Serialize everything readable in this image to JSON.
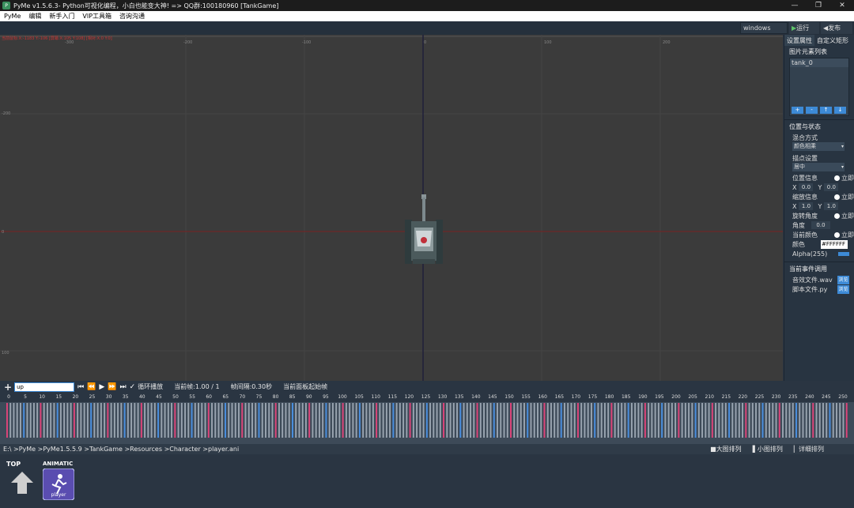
{
  "window": {
    "title": "PyMe v1.5.6.3- Python可视化编程，小白也能变大神!  => QQ群:100180960   [TankGame]",
    "minimize": "—",
    "maximize": "❐",
    "close": "✕"
  },
  "menu": [
    "PyMe",
    "编辑",
    "新手入门",
    "VIP工具箱",
    "咨询沟通"
  ],
  "toolbar": {
    "platform": "windows",
    "run_label": "运行",
    "publish_label": "发布"
  },
  "canvas": {
    "coords_text": "当前鼠标:X:-1183 Y:-106 [屏幕:X:105 Y:108] [相对:X:0 Y:0]",
    "ruler_h": [
      "-300",
      "-200",
      "-100",
      "0",
      "100",
      "200"
    ],
    "ruler_v": [
      "-200",
      "-100",
      "0",
      "100"
    ],
    "sprite_name": "tank_0"
  },
  "panel": {
    "tab_props": "设置属性",
    "tab_custom": "自定义矩形",
    "image_list_title": "图片元素列表",
    "image_items": [
      "tank_0"
    ],
    "list_btns": [
      "+",
      "-",
      "↑",
      "↓"
    ],
    "pos_state_title": "位置与状态",
    "blend_label": "混合方式",
    "blend_value": "颜色相乘",
    "anchor_label": "描点设置",
    "anchor_value": "居中",
    "position_label": "位置信息",
    "scale_label": "缩放信息",
    "rotation_label": "旋转角度",
    "current_color_label": "当前颜色",
    "immediate": "立即",
    "pos_x_label": "X",
    "pos_x": "0.0",
    "pos_y_label": "Y",
    "pos_y": "0.0",
    "scale_x_label": "X",
    "scale_x": "1.0",
    "scale_y_label": "Y",
    "scale_y": "1.0",
    "angle_label": "角度",
    "angle": "0.0",
    "color_label": "颜色",
    "color_value": "#FFFFFF",
    "alpha_label": "Alpha(255)",
    "event_title": "当前事件调用",
    "sound_label": "音效文件.wav",
    "script_label": "脚本文件.py",
    "browse": "浏览"
  },
  "timeline": {
    "add": "+",
    "anim_name": "up",
    "loop_label": "循环播放",
    "current_frame": "当前帧:1.00 / 1",
    "interval": "帧间隔:0.30秒",
    "panel_start": "当前面板起始帧",
    "frame_numbers": [
      "0",
      "5",
      "10",
      "15",
      "20",
      "25",
      "30",
      "35",
      "40",
      "45",
      "50",
      "55",
      "60",
      "65",
      "70",
      "75",
      "80",
      "85",
      "90",
      "95",
      "100",
      "105",
      "110",
      "115",
      "120",
      "125",
      "130",
      "135",
      "140",
      "145",
      "150",
      "155",
      "160",
      "165",
      "170",
      "175",
      "180",
      "185",
      "190",
      "195",
      "200",
      "205",
      "210",
      "215",
      "220",
      "225",
      "230",
      "235",
      "240",
      "245",
      "250"
    ]
  },
  "status": {
    "path": "E:\\ >PyMe >PyMe1.5.5.9 >TankGame >Resources >Character >player.ani",
    "view_large": "大图排列",
    "view_small": "小图排列",
    "view_detail": "详细排列"
  },
  "assets": [
    {
      "label": "TOP",
      "icon": "up-arrow-icon"
    },
    {
      "label": "ANIMATIC",
      "sublabel": "player",
      "icon": "running-figure-icon"
    }
  ],
  "colors": {
    "accent": "#3d8ad6",
    "frame_blue": "#4a90e2",
    "frame_pink": "#e0447a",
    "frame_gray": "#9aa5b1"
  }
}
